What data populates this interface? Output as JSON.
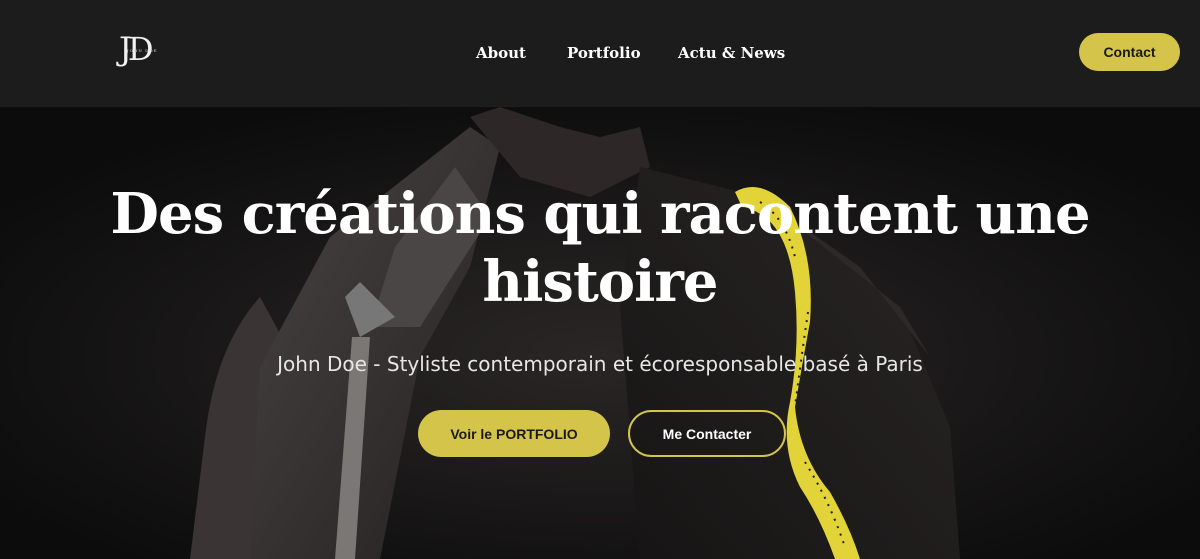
{
  "brand": {
    "logo_letters": "JD",
    "logo_small": "JOHN DOE"
  },
  "nav": {
    "items": [
      {
        "label": "About"
      },
      {
        "label": "Portfolio"
      },
      {
        "label": "Actu & News"
      }
    ],
    "contact_label": "Contact"
  },
  "hero": {
    "title": "Des créations qui racontent une histoire",
    "subtitle": "John Doe - Styliste contemporain et écoresponsable basé à Paris",
    "primary_cta": "Voir le PORTFOLIO",
    "secondary_cta": "Me Contacter"
  },
  "colors": {
    "accent": "#d4c44a",
    "header_bg": "#1c1c1c",
    "hero_bg": "#0d0d0d",
    "text": "#ffffff"
  }
}
